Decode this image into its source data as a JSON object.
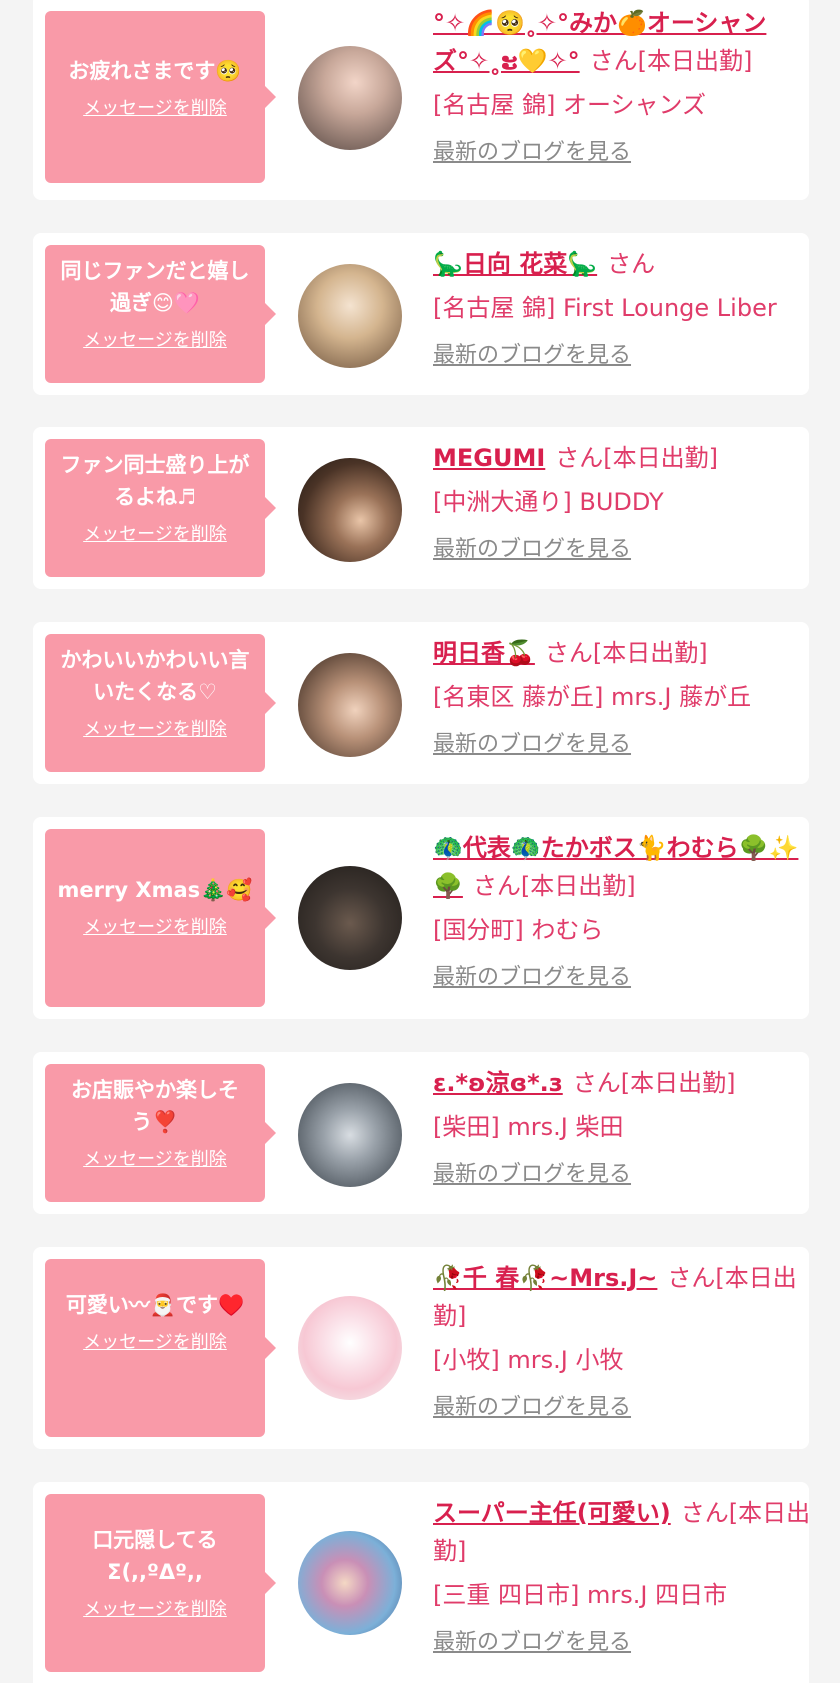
{
  "messages": [
    {
      "message": "お疲れさまです🥺",
      "delete_label": "メッセージを削除",
      "cast_name": "°✧🌈🥺˳✧°みか🍊オーシャンズ°✧˳ະ💛✧°",
      "suffix": "さん[本日出勤]",
      "shop": "[名古屋 錦] オーシャンズ",
      "blog_label": "最新のブログを見る",
      "avatar_color": "#9e8d84"
    },
    {
      "message": "同じファンだと嬉し過ぎ😊🩷",
      "delete_label": "メッセージを削除",
      "cast_name": "🦕日向 花菜🦕",
      "suffix": "さん",
      "shop": "[名古屋 錦] First Lounge Liber",
      "blog_label": "最新のブログを見る",
      "avatar_color": "#c7a57a"
    },
    {
      "message": "ファン同士盛り上がるよね♬",
      "delete_label": "メッセージを削除",
      "cast_name": "MEGUMI",
      "suffix": "さん[本日出勤]",
      "shop": "[中洲大通り] BUDDY",
      "blog_label": "最新のブログを見る",
      "avatar_color": "#4a3326"
    },
    {
      "message": "かわいいかわいい言いたくなる♡",
      "delete_label": "メッセージを削除",
      "cast_name": "明日香🍒",
      "suffix": "さん[本日出勤]",
      "shop": "[名東区 藤が丘] mrs.J 藤が丘",
      "blog_label": "最新のブログを見る",
      "avatar_color": "#8c6a54"
    },
    {
      "message": "merry Xmas🎄🥰",
      "delete_label": "メッセージを削除",
      "cast_name": "🦚代表🦚たかボス🐈わむら🌳✨🌳",
      "suffix": "さん[本日出勤]",
      "shop": "[国分町] わむら",
      "blog_label": "最新のブログを見る",
      "avatar_color": "#2f2a26"
    },
    {
      "message": "お店賑やか楽しそう❣️",
      "delete_label": "メッセージを削除",
      "cast_name": "ε.*ʚ涼ɞ*.з",
      "suffix": "さん[本日出勤]",
      "shop": "[柴田] mrs.J 柴田",
      "blog_label": "最新のブログを見る",
      "avatar_color": "#6f7781"
    },
    {
      "message": "可愛い〰🎅です♥️",
      "delete_label": "メッセージを削除",
      "cast_name": "🥀千 春🥀~Mrs.J~",
      "suffix": "さん[本日出勤]",
      "shop": "[小牧] mrs.J 小牧",
      "blog_label": "最新のブログを見る",
      "avatar_color": "#f7c8d4"
    },
    {
      "message": "口元隠してるΣ(,,ºΔº,,",
      "delete_label": "メッセージを削除",
      "cast_name": "スーパー主任(可愛い)",
      "suffix": "さん[本日出勤]",
      "shop": "[三重 四日市] mrs.J 四日市",
      "blog_label": "最新のブログを見る",
      "avatar_color": "#7cb0d8"
    }
  ]
}
